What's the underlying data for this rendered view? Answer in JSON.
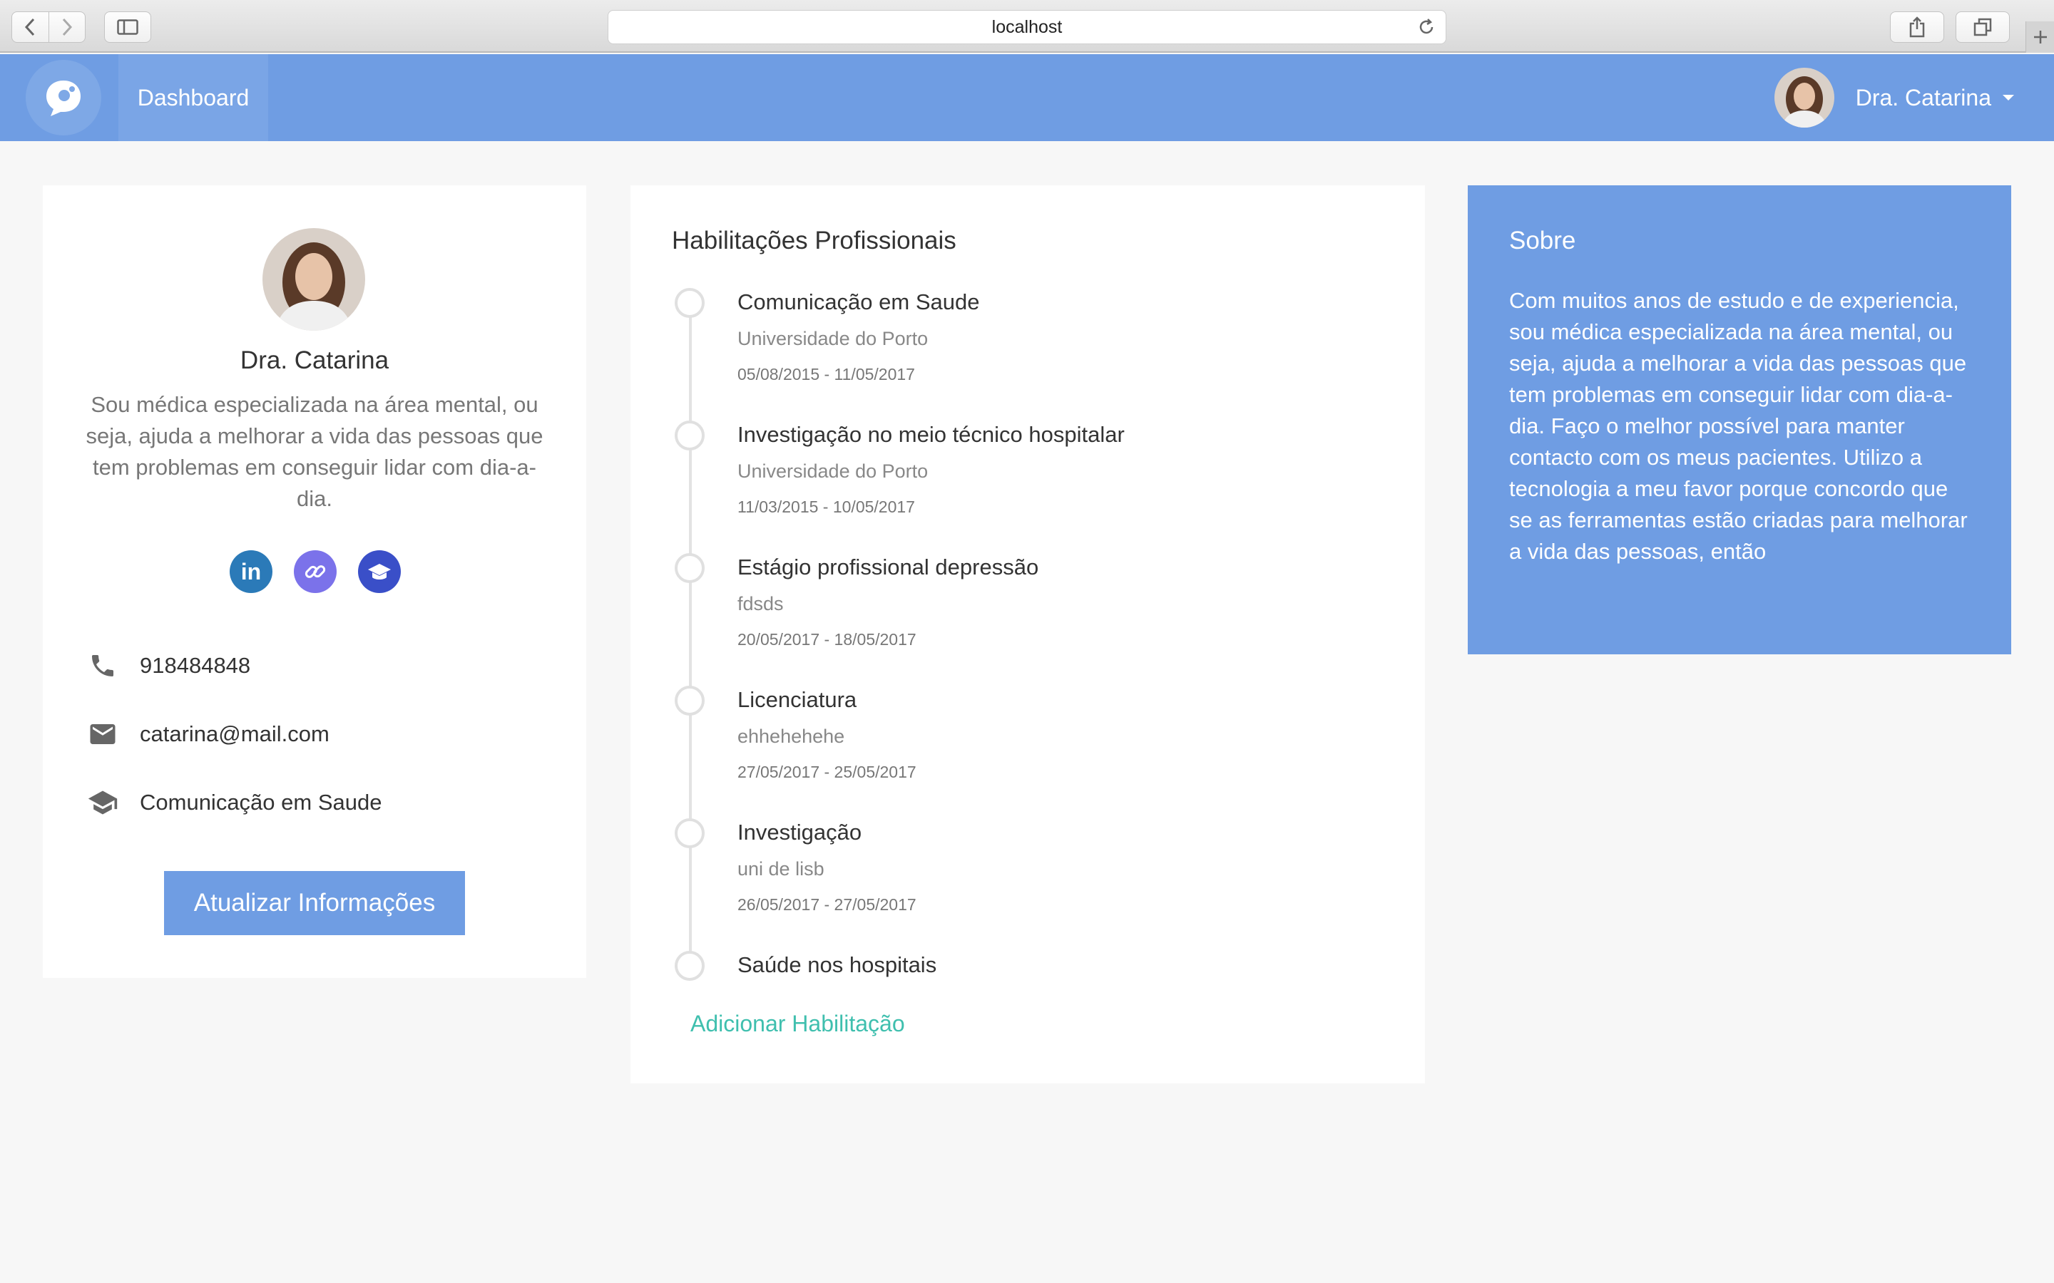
{
  "browser": {
    "url": "localhost"
  },
  "navbar": {
    "brand_icon": "chat-bubble-logo",
    "dashboard_label": "Dashboard",
    "user_name": "Dra. Catarina",
    "color": "#6f9de3"
  },
  "profile": {
    "name": "Dra. Catarina",
    "bio": "Sou médica especializada na área mental, ou seja, ajuda a melhorar a vida das pessoas que tem problemas em conseguir lidar com dia-a-dia.",
    "social": {
      "linkedin_label": "in"
    },
    "phone": "918484848",
    "email": "catarina@mail.com",
    "education": "Comunicação em Saude",
    "update_button": "Atualizar Informações"
  },
  "skills": {
    "title": "Habilitações Profissionais",
    "items": [
      {
        "title": "Comunicação em Saude",
        "institution": "Universidade do Porto",
        "dates": "05/08/2015 - 11/05/2017"
      },
      {
        "title": "Investigação no meio técnico hospitalar",
        "institution": "Universidade do Porto",
        "dates": "11/03/2015 - 10/05/2017"
      },
      {
        "title": "Estágio profissional depressão",
        "institution": "fdsds",
        "dates": "20/05/2017 - 18/05/2017"
      },
      {
        "title": "Licenciatura",
        "institution": "ehhehehehe",
        "dates": "27/05/2017 - 25/05/2017"
      },
      {
        "title": "Investigação",
        "institution": "uni de lisb",
        "dates": "26/05/2017 - 27/05/2017"
      },
      {
        "title": "Saúde nos hospitais",
        "institution": "",
        "dates": ""
      }
    ],
    "add_label": "Adicionar Habilitação"
  },
  "about": {
    "title": "Sobre",
    "text": "Com muitos anos de estudo e de experiencia, sou médica especializada na área mental, ou seja, ajuda a melhorar a vida das pessoas que tem problemas em conseguir lidar com dia-a-dia. Faço o melhor possível para manter contacto com os meus pacientes. Utilizo a tecnologia a meu favor porque concordo que se as ferramentas estão criadas para melhorar a vida das pessoas, então"
  }
}
